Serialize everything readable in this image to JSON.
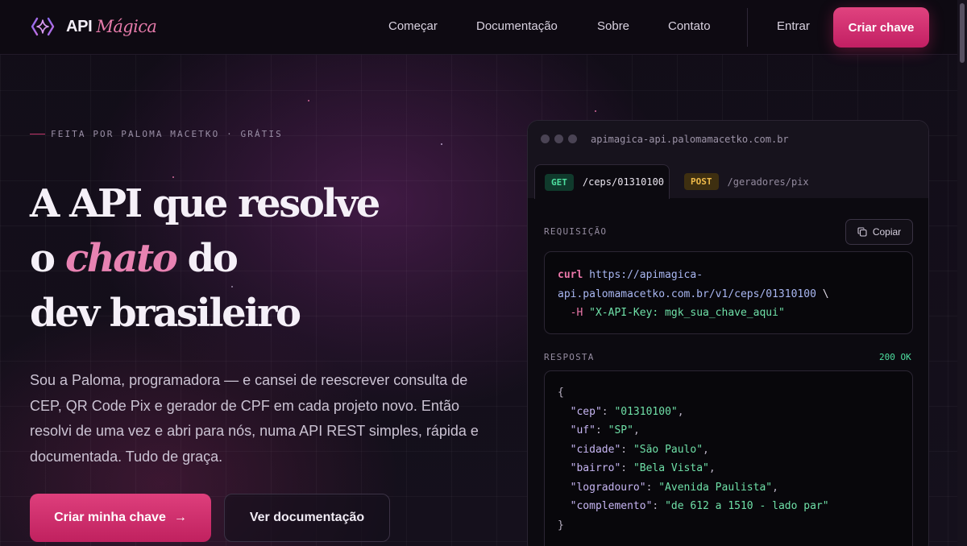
{
  "brand": {
    "name_api": "API",
    "name_magica": "Mágica"
  },
  "nav": {
    "links": [
      "Começar",
      "Documentação",
      "Sobre",
      "Contato"
    ],
    "login": "Entrar",
    "cta": "Criar chave"
  },
  "hero": {
    "eyebrow": "FEITA POR PALOMA MACETKO · GRÁTIS",
    "headline_line1": "A API que resolve",
    "headline_line2_pre": "o ",
    "headline_line2_accent": "chato",
    "headline_line2_post": " do",
    "headline_line3": "dev brasileiro",
    "description": "Sou a Paloma, programadora — e cansei de reescrever consulta de CEP, QR Code Pix e gerador de CPF em cada projeto novo. Então resolvi de uma vez e abri para nós, numa API REST simples, rápida e documentada. Tudo de graça.",
    "primary_button": "Criar minha chave",
    "primary_button_icon": "→",
    "secondary_button": "Ver documentação"
  },
  "code_card": {
    "url": "apimagica-api.palomamacetko.com.br",
    "tabs": [
      {
        "method": "GET",
        "path": "/ceps/01310100"
      },
      {
        "method": "POST",
        "path": "/geradores/pix"
      }
    ],
    "request_label": "REQUISIÇÃO",
    "copy_label": "Copiar",
    "request": {
      "cmd": "curl",
      "url_line1": "https://apimagica-",
      "url_line2": "api.palomamacetko.com.br/v1/ceps/01310100",
      "continuation": " \\",
      "header_flag": "  -H ",
      "header_value": "\"X-API-Key: mgk_sua_chave_aqui\""
    },
    "response_label": "RESPOSTA",
    "status": "200 OK",
    "response": {
      "open": "{",
      "close": "}",
      "fields": [
        {
          "key": "\"cep\"",
          "value": "\"01310100\""
        },
        {
          "key": "\"uf\"",
          "value": "\"SP\""
        },
        {
          "key": "\"cidade\"",
          "value": "\"São Paulo\""
        },
        {
          "key": "\"bairro\"",
          "value": "\"Bela Vista\""
        },
        {
          "key": "\"logradouro\"",
          "value": "\"Avenida Paulista\""
        },
        {
          "key": "\"complemento\"",
          "value": "\"de 612 a 1510 - lado par\""
        }
      ]
    }
  },
  "colors": {
    "accent_pink": "#e0437f",
    "accent_italic": "#e882b2",
    "get_green": "#4ee0a0",
    "post_amber": "#f0bb4a"
  }
}
